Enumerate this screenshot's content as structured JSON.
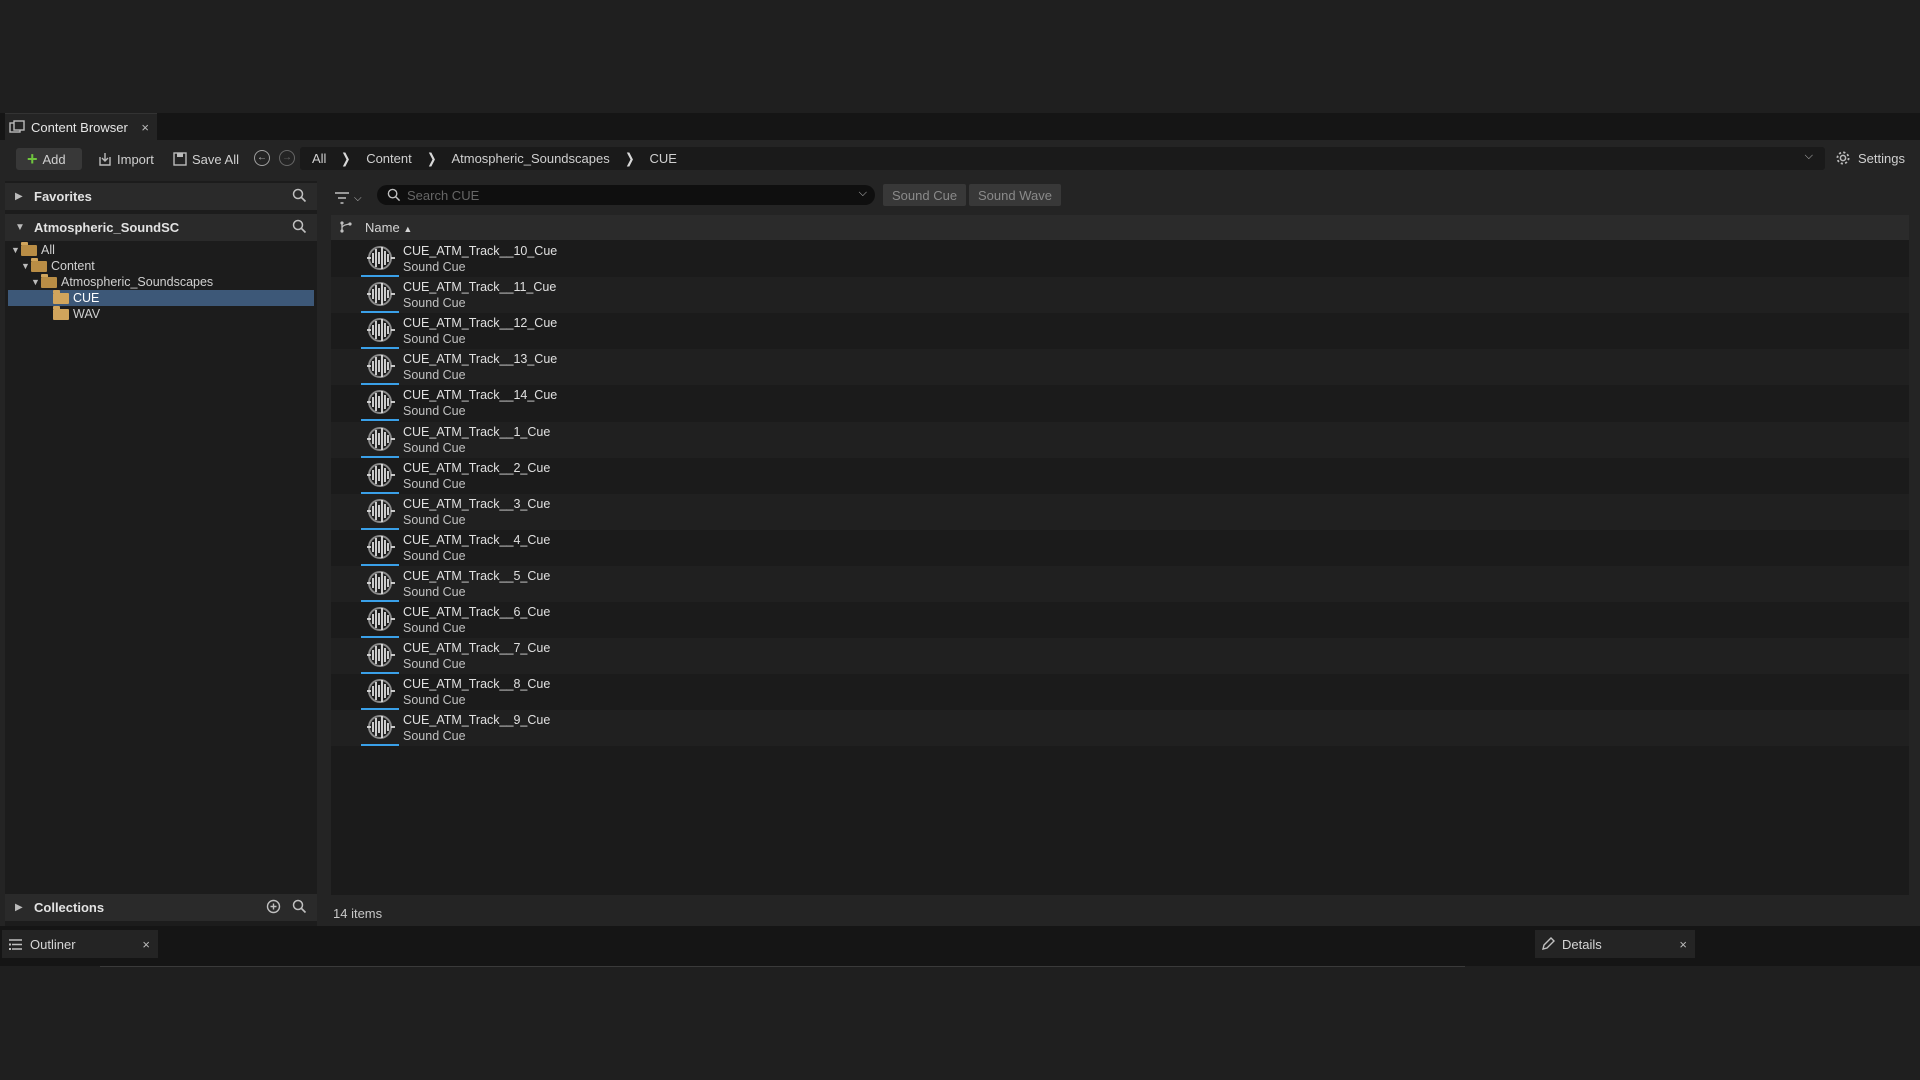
{
  "tabs": {
    "content_browser": "Content Browser",
    "outliner": "Outliner",
    "details": "Details",
    "close_glyph": "×"
  },
  "toolbar": {
    "add_label": "Add",
    "import_label": "Import",
    "save_all_label": "Save All",
    "settings_label": "Settings"
  },
  "breadcrumb": [
    "All",
    "Content",
    "Atmospheric_Soundscapes",
    "CUE"
  ],
  "sidebar": {
    "favorites_label": "Favorites",
    "project_label": "Atmospheric_SoundSC",
    "collections_label": "Collections",
    "tree": [
      {
        "label": "All",
        "depth": 0,
        "expanded": true
      },
      {
        "label": "Content",
        "depth": 1,
        "expanded": true
      },
      {
        "label": "Atmospheric_Soundscapes",
        "depth": 2,
        "expanded": true
      },
      {
        "label": "CUE",
        "depth": 3,
        "selected": true
      },
      {
        "label": "WAV",
        "depth": 3
      }
    ]
  },
  "search": {
    "placeholder": "Search CUE",
    "filter_chips": [
      "Sound Cue",
      "Sound Wave"
    ]
  },
  "list": {
    "column_name": "Name",
    "items": [
      {
        "name": "CUE_ATM_Track__10_Cue",
        "type": "Sound Cue"
      },
      {
        "name": "CUE_ATM_Track__11_Cue",
        "type": "Sound Cue"
      },
      {
        "name": "CUE_ATM_Track__12_Cue",
        "type": "Sound Cue"
      },
      {
        "name": "CUE_ATM_Track__13_Cue",
        "type": "Sound Cue"
      },
      {
        "name": "CUE_ATM_Track__14_Cue",
        "type": "Sound Cue"
      },
      {
        "name": "CUE_ATM_Track__1_Cue",
        "type": "Sound Cue"
      },
      {
        "name": "CUE_ATM_Track__2_Cue",
        "type": "Sound Cue"
      },
      {
        "name": "CUE_ATM_Track__3_Cue",
        "type": "Sound Cue"
      },
      {
        "name": "CUE_ATM_Track__4_Cue",
        "type": "Sound Cue"
      },
      {
        "name": "CUE_ATM_Track__5_Cue",
        "type": "Sound Cue"
      },
      {
        "name": "CUE_ATM_Track__6_Cue",
        "type": "Sound Cue"
      },
      {
        "name": "CUE_ATM_Track__7_Cue",
        "type": "Sound Cue"
      },
      {
        "name": "CUE_ATM_Track__8_Cue",
        "type": "Sound Cue"
      },
      {
        "name": "CUE_ATM_Track__9_Cue",
        "type": "Sound Cue"
      }
    ]
  },
  "status": {
    "item_count": "14 items"
  },
  "icons": {
    "content_browser_tab": "content-browser-icon",
    "asset_thumb": "sound-cue-icon",
    "settings": "gear-icon"
  },
  "colors": {
    "selection": "#3d5878",
    "accent_blue": "#3aa0e8",
    "add_green": "#6fc53d",
    "folder": "#d1a55c"
  }
}
